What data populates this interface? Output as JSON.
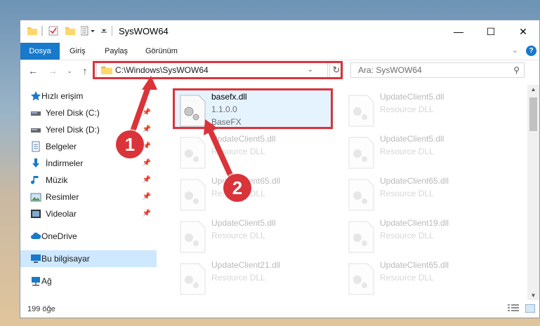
{
  "window": {
    "title": "SysWOW64",
    "minimize_icon": "minimize-icon",
    "maximize_icon": "maximize-icon",
    "close_icon": "close-icon"
  },
  "quick_access_toolbar": {
    "icons": [
      "folder-icon",
      "properties-icon",
      "new-folder-icon",
      "customize-icon",
      "dropdown-icon"
    ]
  },
  "ribbon": {
    "tabs": [
      {
        "label": "Dosya",
        "active": true
      },
      {
        "label": "Giriş"
      },
      {
        "label": "Paylaş"
      },
      {
        "label": "Görünüm"
      }
    ],
    "expand_icon": "chevron-down-icon",
    "help_icon": "help-icon"
  },
  "navigation": {
    "back_icon": "back-arrow-icon",
    "forward_icon": "forward-arrow-icon",
    "recent_icon": "chevron-down-icon",
    "up_icon": "up-arrow-icon",
    "address": "C:\\Windows\\SysWOW64",
    "refresh_icon": "refresh-icon",
    "search_placeholder": "Ara: SysWOW64"
  },
  "sidebar": {
    "items": [
      {
        "label": "Hızlı erişim",
        "icon": "star-icon",
        "pinned": false
      },
      {
        "label": "Yerel Disk (C:)",
        "icon": "drive-icon",
        "pinned": true
      },
      {
        "label": "Yerel Disk (D:)",
        "icon": "drive-icon",
        "pinned": true
      },
      {
        "label": "Belgeler",
        "icon": "documents-icon",
        "pinned": true
      },
      {
        "label": "İndirmeler",
        "icon": "downloads-icon",
        "pinned": true
      },
      {
        "label": "Müzik",
        "icon": "music-icon",
        "pinned": true
      },
      {
        "label": "Resimler",
        "icon": "pictures-icon",
        "pinned": true
      },
      {
        "label": "Videolar",
        "icon": "videos-icon",
        "pinned": true
      },
      {
        "label": "OneDrive",
        "icon": "cloud-icon"
      },
      {
        "label": "Bu bilgisayar",
        "icon": "computer-icon",
        "selected": true
      },
      {
        "label": "Ağ",
        "icon": "network-icon"
      }
    ]
  },
  "files": [
    {
      "name": "basefx.dll",
      "line2": "1.1.0.0",
      "line3": "BaseFX",
      "highlighted": true
    },
    {
      "name": "UpdateClient5.dll",
      "line2": "Resource DLL"
    },
    {
      "name": "UpdateClient5.dll",
      "line2": "Resource DLL"
    },
    {
      "name": "UpdateClient5.dll",
      "line2": "Resource DLL"
    },
    {
      "name": "UpdateClient65.dll",
      "line2": "Resource DLL"
    },
    {
      "name": "UpdateClient65.dll",
      "line2": "Resource DLL"
    },
    {
      "name": "UpdateClient5.dll",
      "line2": "Resource DLL"
    },
    {
      "name": "UpdateClient19.dll",
      "line2": "Resource DLL"
    },
    {
      "name": "UpdateClient21.dll",
      "line2": "Resource DLL"
    },
    {
      "name": "UpdateClient65.dll",
      "line2": "Resource DLL"
    }
  ],
  "status": {
    "item_count": "199 öğe",
    "details_view_icon": "details-view-icon",
    "large_icons_view_icon": "large-icons-view-icon"
  },
  "callouts": [
    {
      "number": "1"
    },
    {
      "number": "2"
    }
  ],
  "colors": {
    "accent": "#1979ca",
    "callout": "#d9343a",
    "selection": "#cde8ff"
  }
}
